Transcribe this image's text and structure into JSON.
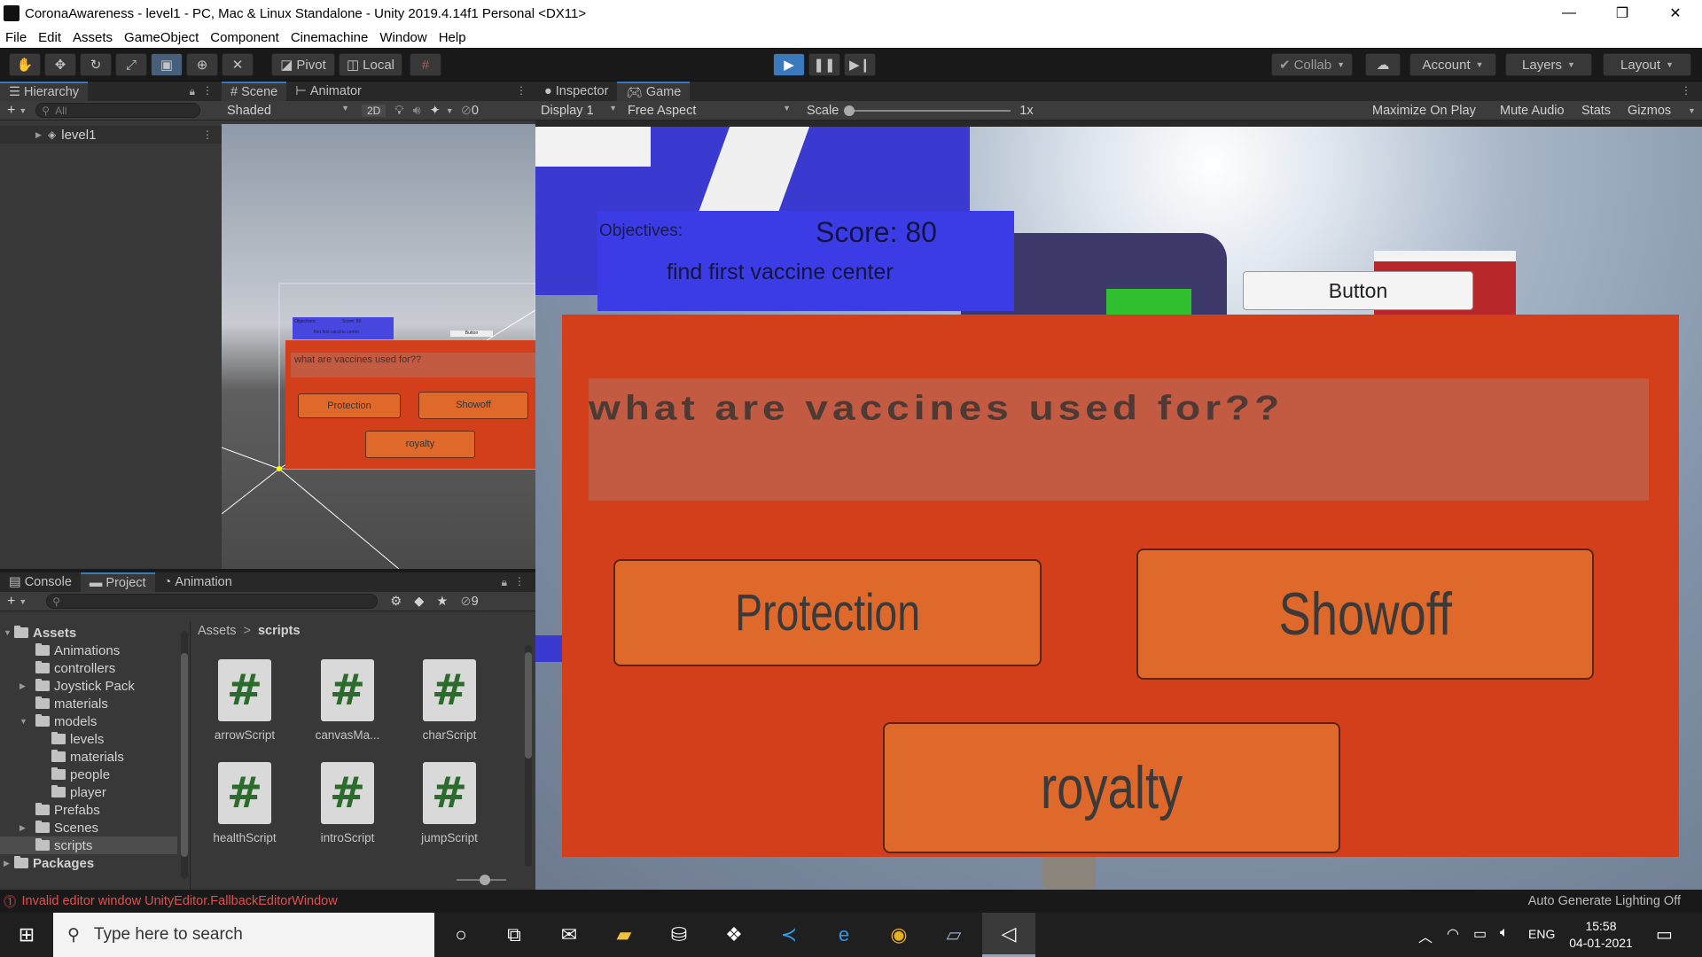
{
  "window": {
    "title": "CoronaAwareness - level1 - PC, Mac & Linux Standalone - Unity 2019.4.14f1 Personal <DX11>",
    "minimize": "—",
    "maximize": "❐",
    "close": "✕"
  },
  "menu": [
    "File",
    "Edit",
    "Assets",
    "GameObject",
    "Component",
    "Cinemachine",
    "Window",
    "Help"
  ],
  "toolbar": {
    "pivot": "Pivot",
    "local": "Local",
    "collab": "Collab",
    "account": "Account",
    "layers": "Layers",
    "layout": "Layout"
  },
  "hierarchy": {
    "tab": "Hierarchy",
    "search_placeholder": "All",
    "scene_item": "level1"
  },
  "scene": {
    "tab_scene": "Scene",
    "tab_animator": "Animator",
    "shading": "Shaded",
    "mode_2d": "2D",
    "hidden_count": "0",
    "objectives": "Objectives:",
    "score": "Score: 80",
    "objective_text": "find first vaccine center",
    "button": "Button",
    "question": "what are vaccines used for??",
    "answer1": "Protection",
    "answer2": "Showoff",
    "answer3": "royalty"
  },
  "game": {
    "tab_inspector": "Inspector",
    "tab_game": "Game",
    "display": "Display 1",
    "aspect": "Free Aspect",
    "scale_label": "Scale",
    "scale_value": "1x",
    "maximize": "Maximize On Play",
    "mute": "Mute Audio",
    "stats": "Stats",
    "gizmos": "Gizmos",
    "objectives": "Objectives:",
    "score": "Score: 80",
    "objective_text": "find first vaccine center",
    "button": "Button",
    "question": "what are vaccines used for??",
    "answer1": "Protection",
    "answer2": "Showoff",
    "answer3": "royalty"
  },
  "project": {
    "tab_console": "Console",
    "tab_project": "Project",
    "tab_animation": "Animation",
    "hidden_count": "9",
    "breadcrumb_root": "Assets",
    "breadcrumb_sep": ">",
    "breadcrumb_current": "scripts",
    "tree": [
      {
        "label": "Assets",
        "indent": 0,
        "arrow": "▼",
        "bold": true
      },
      {
        "label": "Animations",
        "indent": 1,
        "arrow": ""
      },
      {
        "label": "controllers",
        "indent": 1,
        "arrow": ""
      },
      {
        "label": "Joystick Pack",
        "indent": 1,
        "arrow": "▶"
      },
      {
        "label": "materials",
        "indent": 1,
        "arrow": ""
      },
      {
        "label": "models",
        "indent": 1,
        "arrow": "▼"
      },
      {
        "label": "levels",
        "indent": 2,
        "arrow": ""
      },
      {
        "label": "materials",
        "indent": 2,
        "arrow": ""
      },
      {
        "label": "people",
        "indent": 2,
        "arrow": ""
      },
      {
        "label": "player",
        "indent": 2,
        "arrow": ""
      },
      {
        "label": "Prefabs",
        "indent": 1,
        "arrow": ""
      },
      {
        "label": "Scenes",
        "indent": 1,
        "arrow": "▶"
      },
      {
        "label": "scripts",
        "indent": 1,
        "arrow": "",
        "selected": true
      },
      {
        "label": "Packages",
        "indent": 0,
        "arrow": "▶",
        "bold": true
      }
    ],
    "assets": [
      "arrowScript",
      "canvasMa...",
      "charScript",
      "healthScript",
      "introScript",
      "jumpScript"
    ],
    "asset_glyph": "#"
  },
  "status": {
    "error": "Invalid editor window UnityEditor.FallbackEditorWindow",
    "lighting": "Auto Generate Lighting Off"
  },
  "taskbar": {
    "search_placeholder": "Type here to search",
    "lang": "ENG",
    "time": "15:58",
    "date": "04-01-2021"
  },
  "colors": {
    "accent": "#3a79bb",
    "quiz_panel": "#d23f1a",
    "answer_button": "#df692b",
    "objectives_panel": "#3c3ce6",
    "error": "#e05050"
  }
}
